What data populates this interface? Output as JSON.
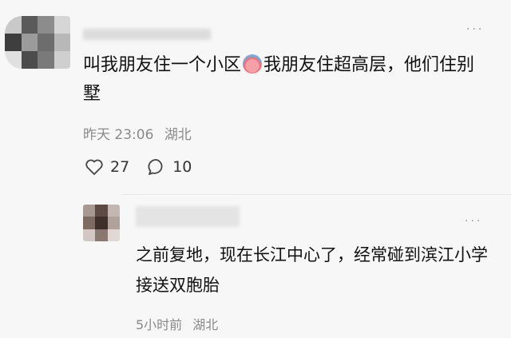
{
  "comment": {
    "text_before_emoji": "叫我朋友住一个小区",
    "text_after_emoji": "我朋友住超高层，他们住别墅",
    "time": "昨天 23:06",
    "location": "湖北",
    "likes": "27",
    "replies": "10"
  },
  "reply": {
    "text": "之前复地，现在长江中心了，经常碰到滨江小学接送双胞胎",
    "time": "5小时前",
    "location": "湖北"
  },
  "more_glyph": "···",
  "icons": {
    "like": "heart-outline-icon",
    "reply": "speech-bubble-icon",
    "emoji": "piggy-face-emoji-icon"
  },
  "colors": {
    "background": "#f7f7f7",
    "text": "#111111",
    "meta": "#8a8a8a"
  }
}
